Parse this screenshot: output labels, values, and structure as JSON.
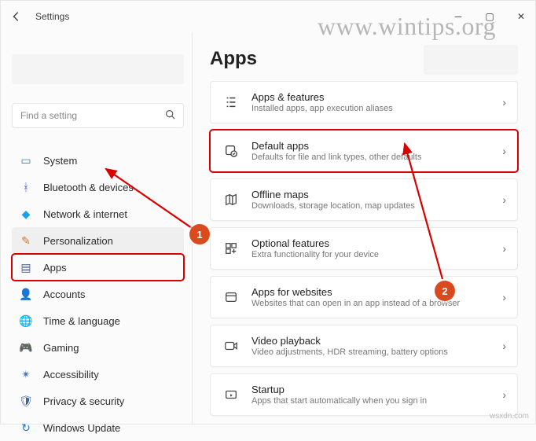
{
  "window": {
    "title": "Settings"
  },
  "watermark": "www.wintips.org",
  "watermark_bottom": "wsxdn.com",
  "search": {
    "placeholder": "Find a setting"
  },
  "sidebar": {
    "items": [
      {
        "label": "System"
      },
      {
        "label": "Bluetooth & devices"
      },
      {
        "label": "Network & internet"
      },
      {
        "label": "Personalization"
      },
      {
        "label": "Apps"
      },
      {
        "label": "Accounts"
      },
      {
        "label": "Time & language"
      },
      {
        "label": "Gaming"
      },
      {
        "label": "Accessibility"
      },
      {
        "label": "Privacy & security"
      },
      {
        "label": "Windows Update"
      }
    ]
  },
  "page": {
    "title": "Apps"
  },
  "cards": [
    {
      "title": "Apps & features",
      "subtitle": "Installed apps, app execution aliases"
    },
    {
      "title": "Default apps",
      "subtitle": "Defaults for file and link types, other defaults"
    },
    {
      "title": "Offline maps",
      "subtitle": "Downloads, storage location, map updates"
    },
    {
      "title": "Optional features",
      "subtitle": "Extra functionality for your device"
    },
    {
      "title": "Apps for websites",
      "subtitle": "Websites that can open in an app instead of a browser"
    },
    {
      "title": "Video playback",
      "subtitle": "Video adjustments, HDR streaming, battery options"
    },
    {
      "title": "Startup",
      "subtitle": "Apps that start automatically when you sign in"
    }
  ],
  "annotations": {
    "step1": "1",
    "step2": "2"
  }
}
